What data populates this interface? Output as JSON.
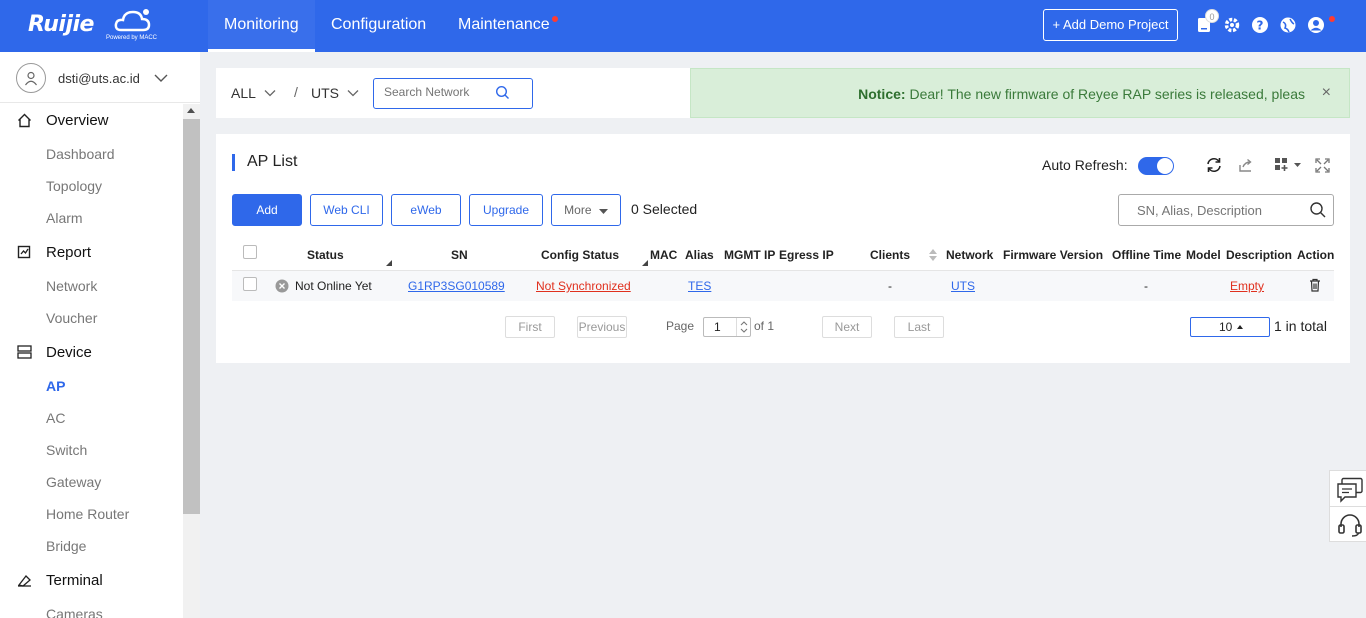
{
  "app": {
    "brand": "Ruijie",
    "powered": "Powered by MACC"
  },
  "topnav": {
    "items": [
      {
        "label": "Monitoring",
        "active": true
      },
      {
        "label": "Configuration",
        "active": false
      },
      {
        "label": "Maintenance",
        "active": false,
        "dot": true
      }
    ],
    "demo_button": "+ Add Demo Project",
    "notification_count": "0",
    "icons": [
      "notification-icon",
      "gear-icon",
      "help-icon",
      "globe-icon",
      "user-icon"
    ]
  },
  "sidebar": {
    "user_email": "dsti@uts.ac.id",
    "sections": [
      {
        "label": "Overview",
        "icon": "home-icon",
        "items": [
          "Dashboard",
          "Topology",
          "Alarm"
        ]
      },
      {
        "label": "Report",
        "icon": "report-icon",
        "items": [
          "Network",
          "Voucher"
        ]
      },
      {
        "label": "Device",
        "icon": "device-icon",
        "items": [
          "AP",
          "AC",
          "Switch",
          "Gateway",
          "Home Router",
          "Bridge"
        ]
      },
      {
        "label": "Terminal",
        "icon": "terminal-icon",
        "items": [
          "Cameras"
        ]
      }
    ],
    "active_item": "AP"
  },
  "filter": {
    "group": "ALL",
    "separator": "/",
    "network": "UTS",
    "search_placeholder": "Search Network"
  },
  "notice": {
    "label": "Notice:",
    "text": " Dear! The new firmware of Reyee RAP series is released, pleas",
    "close": "×"
  },
  "panel": {
    "title": "AP List",
    "auto_refresh_label": "Auto Refresh:",
    "auto_refresh_on": true,
    "buttons": {
      "add": "Add",
      "web_cli": "Web CLI",
      "eweb": "eWeb",
      "upgrade": "Upgrade",
      "more": "More"
    },
    "selected_text": "0 Selected",
    "search_placeholder": "SN, Alias, Description"
  },
  "table": {
    "columns": [
      "Status",
      "SN",
      "Config Status",
      "MAC",
      "Alias",
      "MGMT IP",
      "Egress IP",
      "Clients",
      "Network",
      "Firmware Version",
      "Offline Time",
      "Model",
      "Description",
      "Action"
    ],
    "rows": [
      {
        "status": "Not Online Yet",
        "sn": "G1RP3SG010589",
        "config_status": "Not Synchronized",
        "mac": "",
        "alias": "TES",
        "mgmt_ip": "",
        "egress_ip": "",
        "clients": "-",
        "network": "UTS",
        "firmware": "",
        "offline_time": "-",
        "model": "",
        "description": "Empty",
        "action_icon": "trash-icon"
      }
    ]
  },
  "pagination": {
    "first": "First",
    "previous": "Previous",
    "page_label": "Page",
    "page": "1",
    "of_label": "of 1",
    "next": "Next",
    "last": "Last",
    "per_page": "10",
    "total": "1 in total"
  },
  "colors": {
    "primary": "#2f68ea",
    "notice_bg": "#d9eed9",
    "error": "#e0301e"
  }
}
